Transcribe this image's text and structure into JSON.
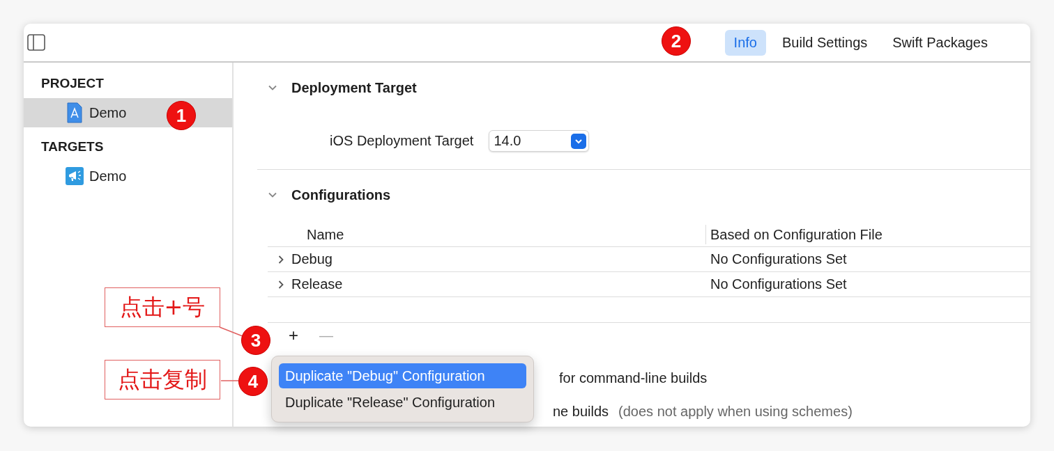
{
  "toolbar": {
    "tabs": [
      {
        "label": "Info",
        "selected": true
      },
      {
        "label": "Build Settings",
        "selected": false
      },
      {
        "label": "Swift Packages",
        "selected": false
      }
    ]
  },
  "sidebar": {
    "sections": [
      {
        "title": "PROJECT",
        "items": [
          {
            "label": "Demo",
            "kind": "project",
            "selected": true
          }
        ]
      },
      {
        "title": "TARGETS",
        "items": [
          {
            "label": "Demo",
            "kind": "target",
            "selected": false
          }
        ]
      }
    ]
  },
  "deployment": {
    "title": "Deployment Target",
    "expanded": true,
    "label": "iOS Deployment Target",
    "value": "14.0"
  },
  "configurations": {
    "title": "Configurations",
    "expanded": true,
    "columns": [
      "Name",
      "Based on Configuration File"
    ],
    "rows": [
      {
        "name": "Debug",
        "file": "No Configurations Set",
        "expanded": false
      },
      {
        "name": "Release",
        "file": "No Configurations Set",
        "expanded": false
      }
    ],
    "add": "+",
    "remove": "—"
  },
  "build_options": [
    {
      "label": "for command-line builds"
    },
    {
      "label": "ne builds",
      "note": "(does not apply when using schemes)"
    }
  ],
  "menu": [
    {
      "label": "Duplicate \"Debug\" Configuration",
      "selected": true
    },
    {
      "label": "Duplicate \"Release\" Configuration",
      "selected": false
    }
  ],
  "annotations": {
    "badges": [
      "1",
      "2",
      "3",
      "4"
    ],
    "callouts": [
      "点击+号",
      "点击复制"
    ]
  }
}
